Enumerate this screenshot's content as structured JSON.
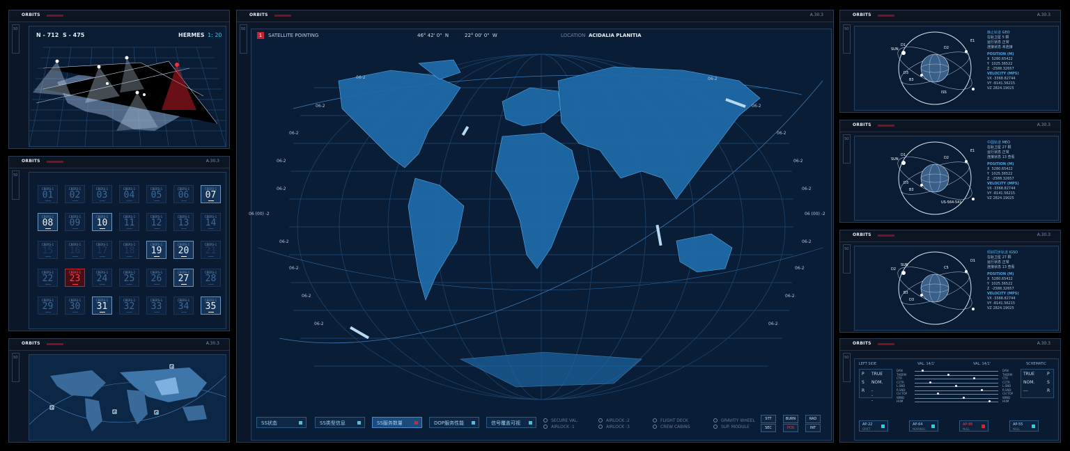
{
  "header_label": "ORBITS",
  "code_label": "A.30.3",
  "side_label": "50",
  "hermes": {
    "left": "N - 712",
    "right": "S - 475",
    "title": "HERMES",
    "ratio": "1: 20"
  },
  "grid": {
    "tile_label": "CBERS-1",
    "tiles": [
      {
        "n": "01",
        "s": "dim"
      },
      {
        "n": "02",
        "s": "dim"
      },
      {
        "n": "03",
        "s": "dim"
      },
      {
        "n": "04",
        "s": "dim"
      },
      {
        "n": "05",
        "s": "dim"
      },
      {
        "n": "06",
        "s": "dim"
      },
      {
        "n": "07",
        "s": "on"
      },
      {
        "n": "08",
        "s": "on"
      },
      {
        "n": "09",
        "s": "dim"
      },
      {
        "n": "10",
        "s": "on"
      },
      {
        "n": "11",
        "s": "dim"
      },
      {
        "n": "12",
        "s": "dim"
      },
      {
        "n": "13",
        "s": "dim"
      },
      {
        "n": "14",
        "s": "dim"
      },
      {
        "n": "15",
        "s": "off"
      },
      {
        "n": "16",
        "s": "off"
      },
      {
        "n": "17",
        "s": "off"
      },
      {
        "n": "18",
        "s": "off"
      },
      {
        "n": "19",
        "s": "on"
      },
      {
        "n": "20",
        "s": "on"
      },
      {
        "n": "21",
        "s": "off"
      },
      {
        "n": "22",
        "s": "dim"
      },
      {
        "n": "23",
        "s": "red"
      },
      {
        "n": "24",
        "s": "dim"
      },
      {
        "n": "25",
        "s": "dim"
      },
      {
        "n": "26",
        "s": "dim"
      },
      {
        "n": "27",
        "s": "on"
      },
      {
        "n": "28",
        "s": "dim"
      },
      {
        "n": "29",
        "s": "dim"
      },
      {
        "n": "30",
        "s": "dim"
      },
      {
        "n": "31",
        "s": "on"
      },
      {
        "n": "32",
        "s": "dim"
      },
      {
        "n": "33",
        "s": "dim"
      },
      {
        "n": "34",
        "s": "dim"
      },
      {
        "n": "35",
        "s": "on"
      }
    ]
  },
  "main": {
    "index": "1",
    "title": "SATELLITE POINTING",
    "lat": "46° 42' 0\"  N",
    "lon": "22° 00' 0\"  W",
    "location_label": "LOCATION",
    "location": "ACIDALIA PLANITIA",
    "tag": "06-2",
    "left_tag": "06 (00) -2",
    "right_tag": "06 (00) -2",
    "buttons": [
      "SS状态",
      "SS类型信息",
      "SS服务数量",
      "DOP服务性能",
      "信号覆盖可视"
    ],
    "options": [
      "SECURE VAL.",
      "AIRLOCK :1",
      "AIRLOCK :2",
      "AIRLOCK :3",
      "FLIGHT DECK",
      "CREW CABINS",
      "GRAVITY WHEEL",
      "SUP. MODULE"
    ],
    "minis": [
      "STT",
      "BURN",
      "RAD",
      "SEC",
      "POS",
      "INT"
    ]
  },
  "orbits": [
    {
      "type": "静止轨道",
      "code": "GEO",
      "r1": "在轨卫星",
      "v1": "5 颗",
      "r2": "运行状态",
      "v2": "正常",
      "r3": "连接状态",
      "v3": "未连接",
      "pos": "POSITION (M)",
      "x": "5280.65422",
      "y": "1025.36522",
      "z": "-2588.32657",
      "vel": "VELOCITY (MPS)",
      "vx": "-3368.82744",
      "vy": "-8141.56215",
      "vz": "2824.19025",
      "labels": [
        "SUN",
        "D1",
        "D2",
        "E1",
        "D3",
        "B3",
        "ISS"
      ]
    },
    {
      "type": "中圆轨道",
      "code": "MEO",
      "r1": "在轨卫星",
      "v1": "27 颗",
      "r2": "运行状态",
      "v2": "正常",
      "r3": "连接状态",
      "v3": "13  查看",
      "pos": "POSITION (M)",
      "x": "5280.65422",
      "y": "1025.36522",
      "z": "-2588.32657",
      "vel": "VELOCITY (MPS)",
      "vx": "-3368.82744",
      "vy": "-8141.56215",
      "vz": "2824.19025",
      "labels": [
        "SUN",
        "D1",
        "D2",
        "E1",
        "D3",
        "B3",
        "US-564-541"
      ]
    },
    {
      "type": "倾斜同步轨道",
      "code": "IGSO",
      "r1": "在轨卫星",
      "v1": "27 颗",
      "r2": "运行状态",
      "v2": "正常",
      "r3": "连接状态",
      "v3": "13  查看",
      "pos": "POSITION (M)",
      "x": "5280.65422",
      "y": "1025.36522",
      "z": "-2588.32657",
      "vel": "VELOCITY (MPS)",
      "vx": "-3368.82744",
      "vy": "-8141.56215",
      "vz": "2824.19025",
      "labels": [
        "D2",
        "SUN",
        "C5",
        "D1",
        "B3",
        "D3"
      ]
    }
  ],
  "schematic": {
    "left_title": "LEFT SIDE",
    "val1": "VAL. 14/1'",
    "val2": "VAL. 14/1'",
    "right_title": "SCHEMATIC",
    "left": [
      [
        "P",
        "TRUE"
      ],
      [
        "S",
        "NOM."
      ],
      [
        "R",
        "---"
      ]
    ],
    "right": [
      [
        "TRUE",
        "P"
      ],
      [
        "NOM.",
        "S"
      ],
      [
        "---",
        "R"
      ]
    ],
    "rows": [
      "DAN",
      "THERM",
      "CTR",
      "CCTR",
      "L.SND",
      "R.SND",
      "CH.TOP",
      "WIND",
      "HUM"
    ],
    "aps": [
      {
        "a": "AP-22",
        "b": "DRIFT",
        "s": ""
      },
      {
        "a": "AP-64",
        "b": "NOMINAL",
        "s": ""
      },
      {
        "a": "AP-86",
        "b": "NULL",
        "s": "red"
      },
      {
        "a": "AP-55",
        "b": "NULL",
        "s": ""
      }
    ]
  }
}
